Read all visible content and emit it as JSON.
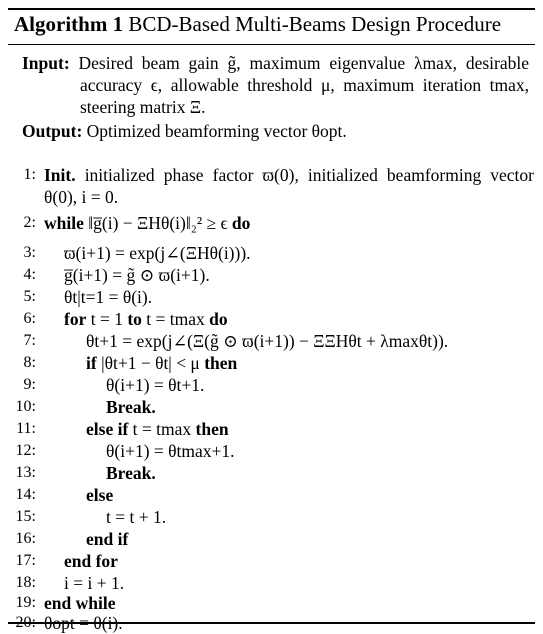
{
  "caption": {
    "label": "Algorithm 1",
    "title": "BCD-Based Multi-Beams Design Procedure"
  },
  "input": {
    "label": "Input:",
    "text": "Desired beam gain g̃, maximum eigenvalue λmax, desirable accuracy ϵ, allowable threshold μ, maximum iteration tmax, steering matrix Ξ."
  },
  "output": {
    "label": "Output:",
    "text": "Optimized beamforming vector θopt."
  },
  "lines": [
    {
      "num": "1:",
      "kw": "Init.",
      "text": "initialized phase factor ϖ(0), initialized beamforming vector θ(0), i = 0."
    },
    {
      "num": "2:",
      "kw": "while",
      "text": "‖g̅(i) − ΞHθ(i)‖₂² ≥ ϵ",
      "kw2": "do"
    },
    {
      "num": "3:",
      "text": "ϖ(i+1) = exp(j∠(ΞHθ(i)))."
    },
    {
      "num": "4:",
      "text": "g̅(i+1) = g̃ ⊙ ϖ(i+1)."
    },
    {
      "num": "5:",
      "text": "θt|t=1 = θ(i)."
    },
    {
      "num": "6:",
      "kw": "for",
      "text": "t = 1",
      "kw2": "to",
      "text2": "t = tmax",
      "kw3": "do"
    },
    {
      "num": "7:",
      "text": "θt+1 = exp(j∠(Ξ(g̃ ⊙ ϖ(i+1)) − ΞΞHθt + λmaxθt))."
    },
    {
      "num": "8:",
      "kw": "if",
      "text": "|θt+1 − θt| < μ",
      "kw2": "then"
    },
    {
      "num": "9:",
      "text": "θ(i+1) = θt+1."
    },
    {
      "num": "10:",
      "kw": "Break."
    },
    {
      "num": "11:",
      "kw": "else if",
      "text": "t = tmax",
      "kw2": "then"
    },
    {
      "num": "12:",
      "text": "θ(i+1) = θtmax+1."
    },
    {
      "num": "13:",
      "kw": "Break."
    },
    {
      "num": "14:",
      "kw": "else"
    },
    {
      "num": "15:",
      "text": "t = t + 1."
    },
    {
      "num": "16:",
      "kw": "end if"
    },
    {
      "num": "17:",
      "kw": "end for"
    },
    {
      "num": "18:",
      "text": "i = i + 1."
    },
    {
      "num": "19:",
      "kw": "end while"
    },
    {
      "num": "20:",
      "text": "θopt = θ(i)."
    }
  ]
}
